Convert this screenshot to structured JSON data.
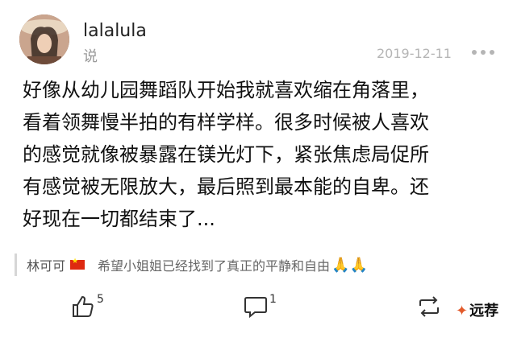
{
  "user": {
    "name": "lalalula",
    "action": "说"
  },
  "post": {
    "date": "2019-12-11",
    "lines": [
      "好像从幼儿园舞蹈队开始我就喜欢缩在角落里，",
      "看着领舞慢半拍的有样学样。很多时候被人喜欢",
      "的感觉就像被暴露在镁光灯下，紧张焦虑局促所",
      "有感觉被无限放大，最后照到最本能的自卑。还",
      "好现在一切都结束了..."
    ]
  },
  "reply": {
    "name": "林可可",
    "text": "希望小姐姐已经找到了真正的平静和自由",
    "emoji": "🙏🙏"
  },
  "actions": {
    "likes": "5",
    "comments": "1"
  },
  "watermark": "远荐",
  "icons": {
    "more": "more-dots-icon",
    "like": "thumbs-up-icon",
    "comment": "comment-icon",
    "share": "repost-icon",
    "flag": "china-flag-icon"
  }
}
